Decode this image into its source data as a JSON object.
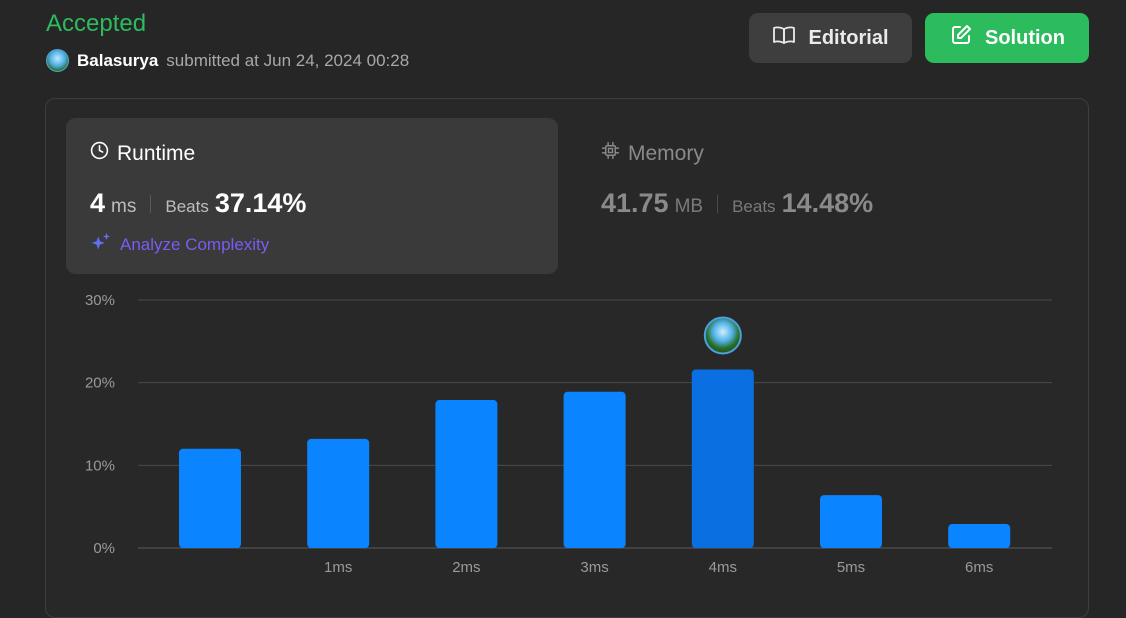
{
  "header": {
    "status": "Accepted",
    "username": "Balasurya",
    "submitted_text": "submitted at Jun 24, 2024 00:28",
    "editorial_label": "Editorial",
    "solution_label": "Solution"
  },
  "runtime": {
    "title": "Runtime",
    "value": "4",
    "unit": "ms",
    "beats_label": "Beats",
    "beats_value": "37.14%",
    "analyze_label": "Analyze Complexity"
  },
  "memory": {
    "title": "Memory",
    "value": "41.75",
    "unit": "MB",
    "beats_label": "Beats",
    "beats_value": "14.48%"
  },
  "colors": {
    "accent_green": "#2cbb5d",
    "bar": "#0a84ff",
    "bar_highlight": "#0a6fe0",
    "analyze": "#7b5cf0"
  },
  "chart_data": {
    "type": "bar",
    "categories": [
      "",
      "1ms",
      "2ms",
      "3ms",
      "4ms",
      "5ms",
      "6ms"
    ],
    "values": [
      12.0,
      13.2,
      17.9,
      18.9,
      21.6,
      6.4,
      2.9
    ],
    "highlight_index": 4,
    "y_ticks": [
      "0%",
      "10%",
      "20%",
      "30%"
    ],
    "ylim": [
      0,
      30
    ],
    "grid": true
  }
}
